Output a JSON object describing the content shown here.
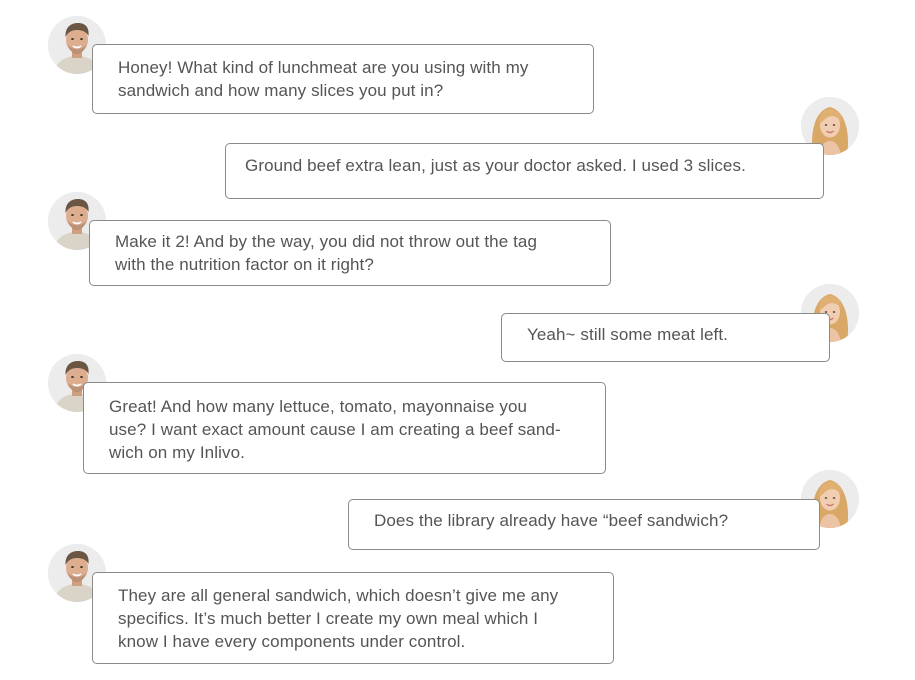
{
  "conversation": {
    "messages": [
      {
        "speaker": "man",
        "text": "Honey! What kind of lunchmeat are you using with my\nsandwich and how many slices you put in?"
      },
      {
        "speaker": "woman",
        "text": "Ground beef extra lean, just as your doctor asked. I used 3 slices."
      },
      {
        "speaker": "man",
        "text": "Make it 2! And by the way, you did not throw out the tag\nwith the nutrition factor on it right?"
      },
      {
        "speaker": "woman",
        "text": "Yeah~ still some meat left."
      },
      {
        "speaker": "man",
        "text": "Great! And how many lettuce, tomato, mayonnaise you\nuse? I want exact amount cause I am creating a beef sand-\nwich on my Inlivo."
      },
      {
        "speaker": "woman",
        "text": "Does the library already have “beef sandwich?"
      },
      {
        "speaker": "man",
        "text": "They are all general sandwich, which doesn’t give me any\nspecifics. It’s much better I create my own meal which I\nknow I have every components under control."
      }
    ]
  },
  "colors": {
    "bubble_border": "#8a8a8a",
    "text": "#555555",
    "avatar_bg": "#ebebeb",
    "man_hair": "#6b5643",
    "man_skin": "#dcae8f",
    "man_shirt": "#d9d3c8",
    "woman_hair": "#d9a866",
    "woman_skin": "#f1cdb2"
  },
  "icons": {
    "man": "man-avatar-icon",
    "woman": "woman-avatar-icon"
  }
}
